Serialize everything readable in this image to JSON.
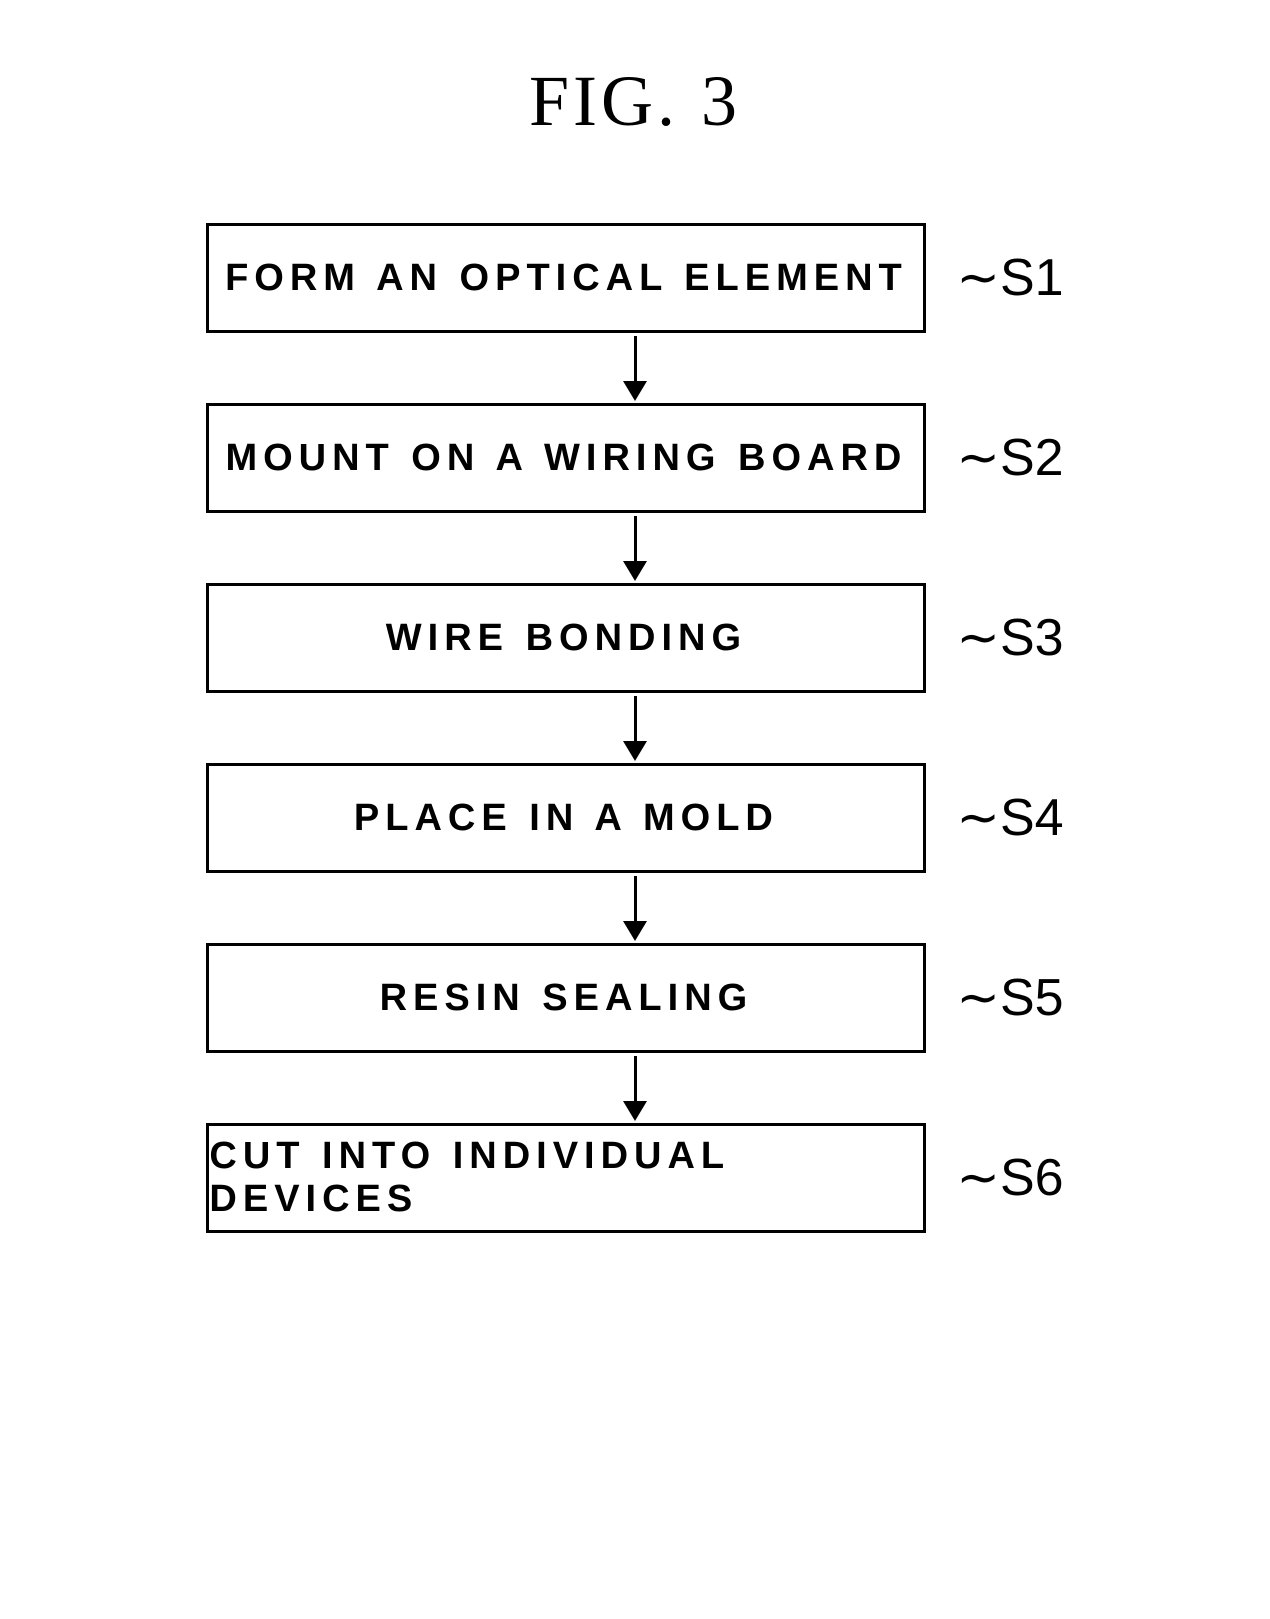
{
  "figure": {
    "title": "FIG. 3"
  },
  "steps": [
    {
      "id": "s1",
      "label": "FORM AN OPTICAL ELEMENT",
      "step_id_text": "S1"
    },
    {
      "id": "s2",
      "label": "MOUNT ON A WIRING BOARD",
      "step_id_text": "S2"
    },
    {
      "id": "s3",
      "label": "WIRE BONDING",
      "step_id_text": "S3"
    },
    {
      "id": "s4",
      "label": "PLACE IN A MOLD",
      "step_id_text": "S4"
    },
    {
      "id": "s5",
      "label": "RESIN SEALING",
      "step_id_text": "S5"
    },
    {
      "id": "s6",
      "label": "CUT INTO INDIVIDUAL DEVICES",
      "step_id_text": "S6"
    }
  ],
  "colors": {
    "border": "#000000",
    "background": "#ffffff",
    "text": "#000000"
  }
}
